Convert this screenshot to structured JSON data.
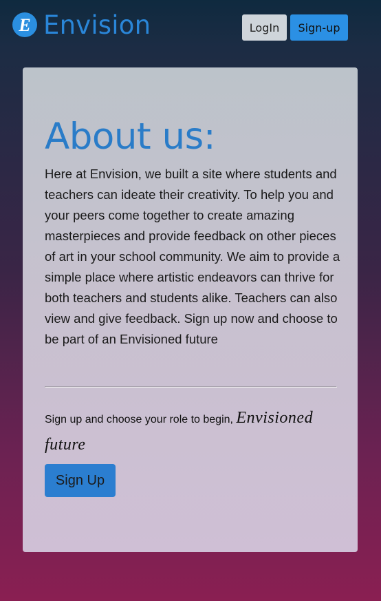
{
  "navbar": {
    "brand": "Envision",
    "logo_letter": "E",
    "login_label": "LogIn",
    "signup_label": "Sign-up"
  },
  "about": {
    "title": "About us:",
    "body": "Here at Envision, we built a site where students and teachers can ideate their creativity. To help you and your peers come together to create amazing masterpieces and provide feedback on other pieces of art in your school community. We aim to provide a simple place where artistic endeavors can thrive for both teachers and students alike. Teachers can also view and give feedback. Sign up now and choose to be part of an Envisioned future"
  },
  "cta": {
    "lead": "Sign up and choose your role to begin,",
    "script": "Envisioned future",
    "button_label": "Sign Up"
  },
  "colors": {
    "brand": "#2a86d8",
    "primary_button": "#2b90e4",
    "title": "#2a7cc8"
  },
  "icons": {
    "logo": "envision-logo-icon"
  }
}
